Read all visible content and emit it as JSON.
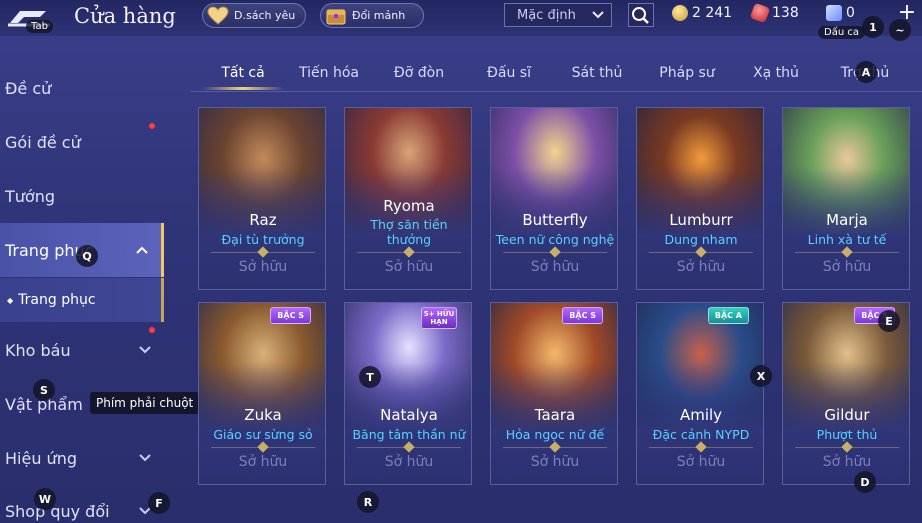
{
  "header": {
    "back_key_hint": "Tab",
    "title": "Cửa hàng",
    "wishlist_label": "D.sách yêu",
    "shards_label": "Đổi mảnh",
    "sort_value": "Mặc định",
    "gold": "2 241",
    "ruby": "138",
    "crystal": "0",
    "key_hint_1": "1",
    "key_hint_tilde": "~",
    "dauca_hint": "Dấu ca",
    "plus_label": "+"
  },
  "sidebar": {
    "items": [
      {
        "label": "Đề cử"
      },
      {
        "label": "Gói đề cử"
      },
      {
        "label": "Tướng"
      },
      {
        "label": "Trang phục"
      },
      {
        "label": "Kho báu"
      },
      {
        "label": "Vật phẩm"
      },
      {
        "label": "Hiệu ứng"
      },
      {
        "label": "Shop quy đổi"
      }
    ],
    "sub_item": "Trang phục",
    "tooltip": "Phím phải chuột"
  },
  "key_hints": {
    "q": "Q",
    "s": "S",
    "w": "W",
    "f": "F",
    "a": "A",
    "t": "T",
    "r": "R",
    "x": "X",
    "e": "E",
    "d": "D"
  },
  "tabs": [
    {
      "label": "Tất cả"
    },
    {
      "label": "Tiến hóa"
    },
    {
      "label": "Đỡ đòn"
    },
    {
      "label": "Đấu sĩ"
    },
    {
      "label": "Sát thủ"
    },
    {
      "label": "Pháp sư"
    },
    {
      "label": "Xạ thủ"
    },
    {
      "label": "Trợ thủ"
    }
  ],
  "cards": [
    {
      "name": "Raz",
      "skin": "Đại tù trưởng",
      "owned": "Sở hữu",
      "badge": ""
    },
    {
      "name": "Ryoma",
      "skin": "Thợ săn tiền thưởng",
      "owned": "Sở hữu",
      "badge": ""
    },
    {
      "name": "Butterfly",
      "skin": "Teen nữ công nghệ",
      "owned": "Sở hữu",
      "badge": ""
    },
    {
      "name": "Lumburr",
      "skin": "Dung nham",
      "owned": "Sở hữu",
      "badge": ""
    },
    {
      "name": "Marja",
      "skin": "Linh xà tư tế",
      "owned": "Sở hữu",
      "badge": ""
    },
    {
      "name": "Zuka",
      "skin": "Giáo sư sừng sỏ",
      "owned": "Sở hữu",
      "badge": "BẬC S"
    },
    {
      "name": "Natalya",
      "skin": "Băng tâm thần nữ",
      "owned": "Sở hữu",
      "badge": "5+ HỮU HẠN"
    },
    {
      "name": "Taara",
      "skin": "Hỏa ngọc nữ đế",
      "owned": "Sở hữu",
      "badge": "BẬC S"
    },
    {
      "name": "Amily",
      "skin": "Đặc cảnh NYPD",
      "owned": "Sở hữu",
      "badge": "BẬC A"
    },
    {
      "name": "Gildur",
      "skin": "Phượt thủ",
      "owned": "Sở hữu",
      "badge": "BẬC S"
    }
  ],
  "colors": {
    "accent_gold": "#f4d17a",
    "skin_name_blue": "#56d2ff",
    "owned_gray": "#7b80b9",
    "notification_red": "#ff3a3a"
  }
}
